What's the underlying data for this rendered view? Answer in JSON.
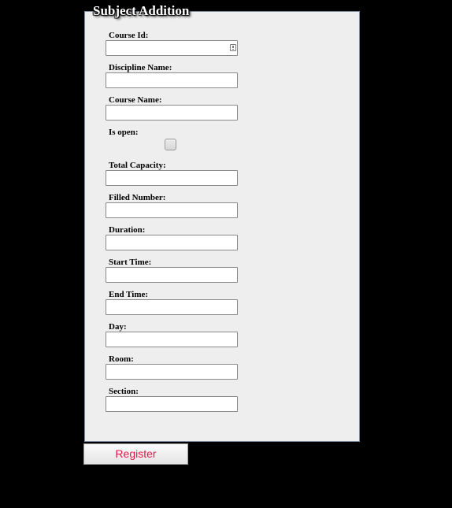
{
  "form": {
    "title": "Subject Addition",
    "fields": {
      "course_id": {
        "label": "Course Id:",
        "value": ""
      },
      "discipline_name": {
        "label": "Discipline Name:",
        "value": ""
      },
      "course_name": {
        "label": "Course Name:",
        "value": ""
      },
      "is_open": {
        "label": "Is open:",
        "checked": false
      },
      "total_capacity": {
        "label": "Total Capacity:",
        "value": ""
      },
      "filled_number": {
        "label": "Filled Number:",
        "value": ""
      },
      "duration": {
        "label": "Duration:",
        "value": ""
      },
      "start_time": {
        "label": "Start Time:",
        "value": ""
      },
      "end_time": {
        "label": "End Time:",
        "value": ""
      },
      "day": {
        "label": "Day:",
        "value": ""
      },
      "room": {
        "label": "Room:",
        "value": ""
      },
      "section": {
        "label": "Section:",
        "value": ""
      }
    },
    "register_label": "Register"
  },
  "colors": {
    "page_background": "#000000",
    "panel_background": "#eeeeee",
    "register_text": "#e21a4c"
  },
  "icons": {
    "course_id_autofill": "autofill-key-icon"
  }
}
